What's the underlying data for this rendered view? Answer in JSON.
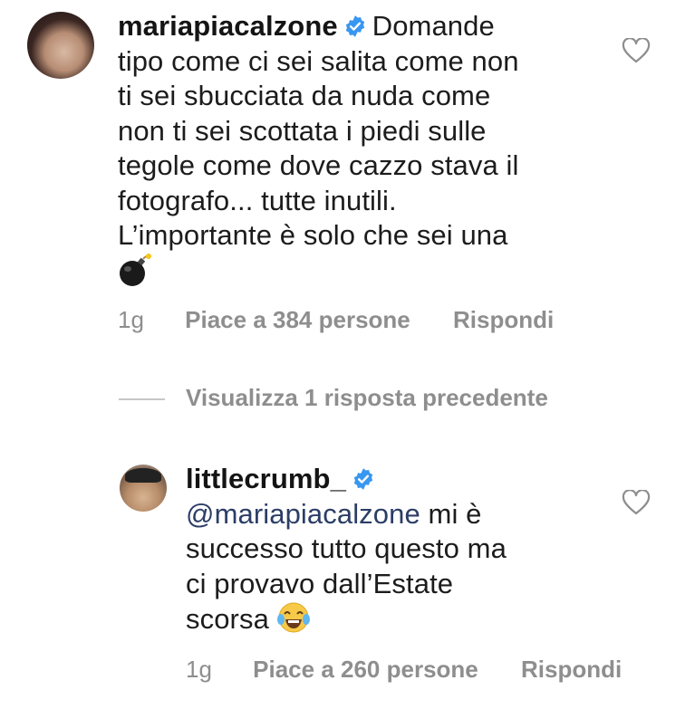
{
  "comment": {
    "username": "mariapiacalzone",
    "lines": [
      "Domande",
      "tipo come ci sei salita come non",
      "ti sei sbucciata da nuda come",
      "non ti sei scottata i piedi sulle",
      "tegole come dove cazzo stava il",
      "fotografo... tutte inutili.",
      "L’importante è solo che sei una"
    ],
    "emoji_icon": "bomb-icon",
    "time": "1g",
    "likes": "Piace a 384 persone",
    "reply": "Rispondi"
  },
  "view_replies": "Visualizza 1 risposta precedente",
  "reply_comment": {
    "username": "littlecrumb_",
    "mention": "@mariapiacalzone",
    "lines": [
      " mi è",
      "successo tutto questo ma",
      "ci provavo dall’Estate",
      "scorsa "
    ],
    "emoji_icon": "laughing-tears-icon",
    "time": "1g",
    "likes": "Piace a 260 persone",
    "reply": "Rispondi"
  },
  "colors": {
    "verified": "#3897f0",
    "meta": "#8e8e8e",
    "mention": "#2c3e66"
  }
}
